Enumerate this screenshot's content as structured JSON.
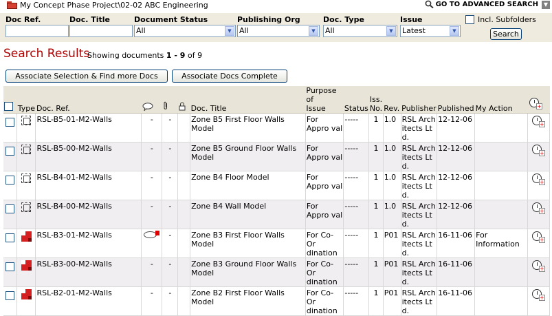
{
  "breadcrumb": "My Concept Phase Project\\02-02 ABC Engineering",
  "advanced_search_label": "GO TO ADVANCED SEARCH",
  "filters": {
    "doc_ref": {
      "label": "Doc Ref.",
      "value": ""
    },
    "doc_title": {
      "label": "Doc. Title",
      "value": ""
    },
    "doc_status": {
      "label": "Document Status",
      "value": "All"
    },
    "publishing_org": {
      "label": "Publishing Org",
      "value": "All"
    },
    "doc_type": {
      "label": "Doc. Type",
      "value": "All"
    },
    "issue": {
      "label": "Issue",
      "value": "Latest"
    },
    "subfolders_label": "Incl. Subfolders",
    "search_label": "Search"
  },
  "results": {
    "title": "Search Results",
    "showing_prefix": "Showing documents",
    "range": "1 - 9",
    "of_text": "of 9"
  },
  "actions": {
    "associate_find": "Associate Selection & Find more Docs",
    "associate_complete": "Associate Docs Complete"
  },
  "columns": {
    "type": "Type",
    "doc_ref": "Doc. Ref.",
    "doc_title": "Doc. Title",
    "purpose_line1": "Purpose of",
    "purpose_line2": "Issue",
    "status": "Status",
    "iss_line1": "Iss.",
    "iss_line2": "No.",
    "rev": "Rev.",
    "publisher": "Publisher",
    "published": "Published",
    "my_action": "My Action"
  },
  "rows": [
    {
      "type": "model",
      "ref": "RSL-B5-01-M2-Walls",
      "comment": "-",
      "attach": "-",
      "title": "Zone B5 First Floor Walls Model",
      "purpose": "For Appro val",
      "status": "-----",
      "iss": "1",
      "rev": "1.0",
      "publisher": "RSL Arch itects Lt d.",
      "published": "12-12-06",
      "action": ""
    },
    {
      "type": "model",
      "ref": "RSL-B5-00-M2-Walls",
      "comment": "-",
      "attach": "-",
      "title": "Zone B5 Ground Floor Walls Model",
      "purpose": "For Appro val",
      "status": "-----",
      "iss": "1",
      "rev": "1.0",
      "publisher": "RSL Arch itects Lt d.",
      "published": "12-12-06",
      "action": ""
    },
    {
      "type": "model",
      "ref": "RSL-B4-01-M2-Walls",
      "comment": "-",
      "attach": "-",
      "title": "Zone B4 Floor Model",
      "purpose": "For Appro val",
      "status": "-----",
      "iss": "1",
      "rev": "1.0",
      "publisher": "RSL Arch itects Lt d.",
      "published": "12-12-06",
      "action": ""
    },
    {
      "type": "model",
      "ref": "RSL-B4-00-M2-Walls",
      "comment": "-",
      "attach": "-",
      "title": "Zone B4 Wall Model",
      "purpose": "For Appro val",
      "status": "-----",
      "iss": "1",
      "rev": "1.0",
      "publisher": "RSL Arch itects Lt d.",
      "published": "12-12-06",
      "action": ""
    },
    {
      "type": "drawing",
      "ref": "RSL-B3-01-M2-Walls",
      "comment": "icon",
      "attach": "-",
      "title": "Zone B3 First Floor Walls Model",
      "purpose": "For Co-Or dination",
      "status": "-----",
      "iss": "1",
      "rev": "P01",
      "publisher": "RSL Arch itects Lt d.",
      "published": "16-11-06",
      "action": "For Information"
    },
    {
      "type": "drawing",
      "ref": "RSL-B3-00-M2-Walls",
      "comment": "-",
      "attach": "-",
      "title": "Zone B3 Ground Floor Walls Model",
      "purpose": "For Co-Or dination",
      "status": "-----",
      "iss": "1",
      "rev": "P01",
      "publisher": "RSL Arch itects Lt d.",
      "published": "16-11-06",
      "action": ""
    },
    {
      "type": "drawing",
      "ref": "RSL-B2-01-M2-Walls",
      "comment": "-",
      "attach": "-",
      "title": "Zone B2 First Floor Walls Model",
      "purpose": "For Co-Or dination",
      "status": "-----",
      "iss": "1",
      "rev": "P01",
      "publisher": "RSL Arch itects Lt d.",
      "published": "16-11-06",
      "action": ""
    }
  ]
}
